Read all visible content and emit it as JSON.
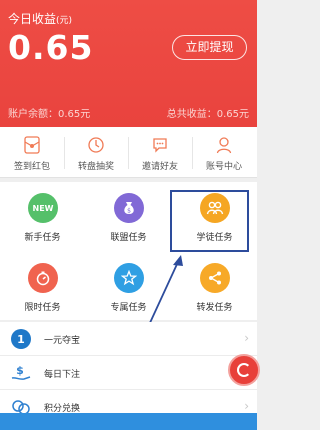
{
  "header": {
    "title": "今日收益",
    "title_unit": "(元)",
    "amount": "0.65",
    "withdraw_label": "立即提现",
    "balance_text": "账户余额：0.65元",
    "total_text": "总共收益：0.65元"
  },
  "quick_actions": [
    {
      "label": "签到红包",
      "icon": "red-envelope-icon"
    },
    {
      "label": "转盘抽奖",
      "icon": "wheel-icon"
    },
    {
      "label": "邀请好友",
      "icon": "chat-icon"
    },
    {
      "label": "账号中心",
      "icon": "user-icon"
    }
  ],
  "tasks": [
    {
      "label": "新手任务",
      "icon": "new-icon",
      "badge": "NEW",
      "color": "#55c06a"
    },
    {
      "label": "联盟任务",
      "icon": "money-bag-icon",
      "color": "#8169d6"
    },
    {
      "label": "学徒任务",
      "icon": "apprentice-icon",
      "color": "#f5a623"
    },
    {
      "label": "限时任务",
      "icon": "timer-icon",
      "color": "#f0634f"
    },
    {
      "label": "专属任务",
      "icon": "star-badge-icon",
      "color": "#2f9fe3"
    },
    {
      "label": "转发任务",
      "icon": "share-icon",
      "color": "#f7a928"
    }
  ],
  "list_items": [
    {
      "label": "一元夺宝",
      "icon": "number-one-icon"
    },
    {
      "label": "每日下注",
      "icon": "dollar-hand-icon"
    },
    {
      "label": "积分兑换",
      "icon": "points-icon"
    }
  ]
}
